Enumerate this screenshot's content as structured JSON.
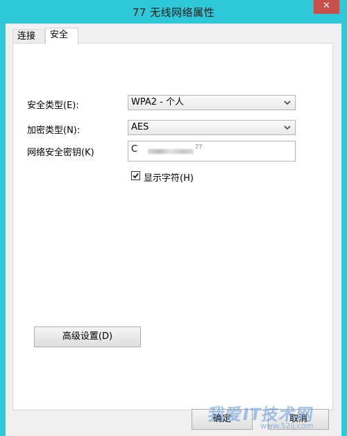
{
  "window": {
    "title": "77 无线网络属性",
    "close_label": "✕"
  },
  "tabs": [
    {
      "label": "连接"
    },
    {
      "label": "安全"
    }
  ],
  "security": {
    "type_label": "安全类型(E):",
    "type_value": "WPA2 - 个人",
    "encryption_label": "加密类型(N):",
    "encryption_value": "AES",
    "key_label": "网络安全密钥(K)",
    "key_value": "C",
    "key_suffix": "??",
    "show_chars_label": "显示字符(H)",
    "show_chars_checked": true,
    "advanced_button": "高级设置(D)"
  },
  "footer": {
    "ok_label": "确定",
    "cancel_label": "取消"
  },
  "watermark": {
    "text": "我爱IT技术网",
    "url": "www.52ij.com"
  }
}
